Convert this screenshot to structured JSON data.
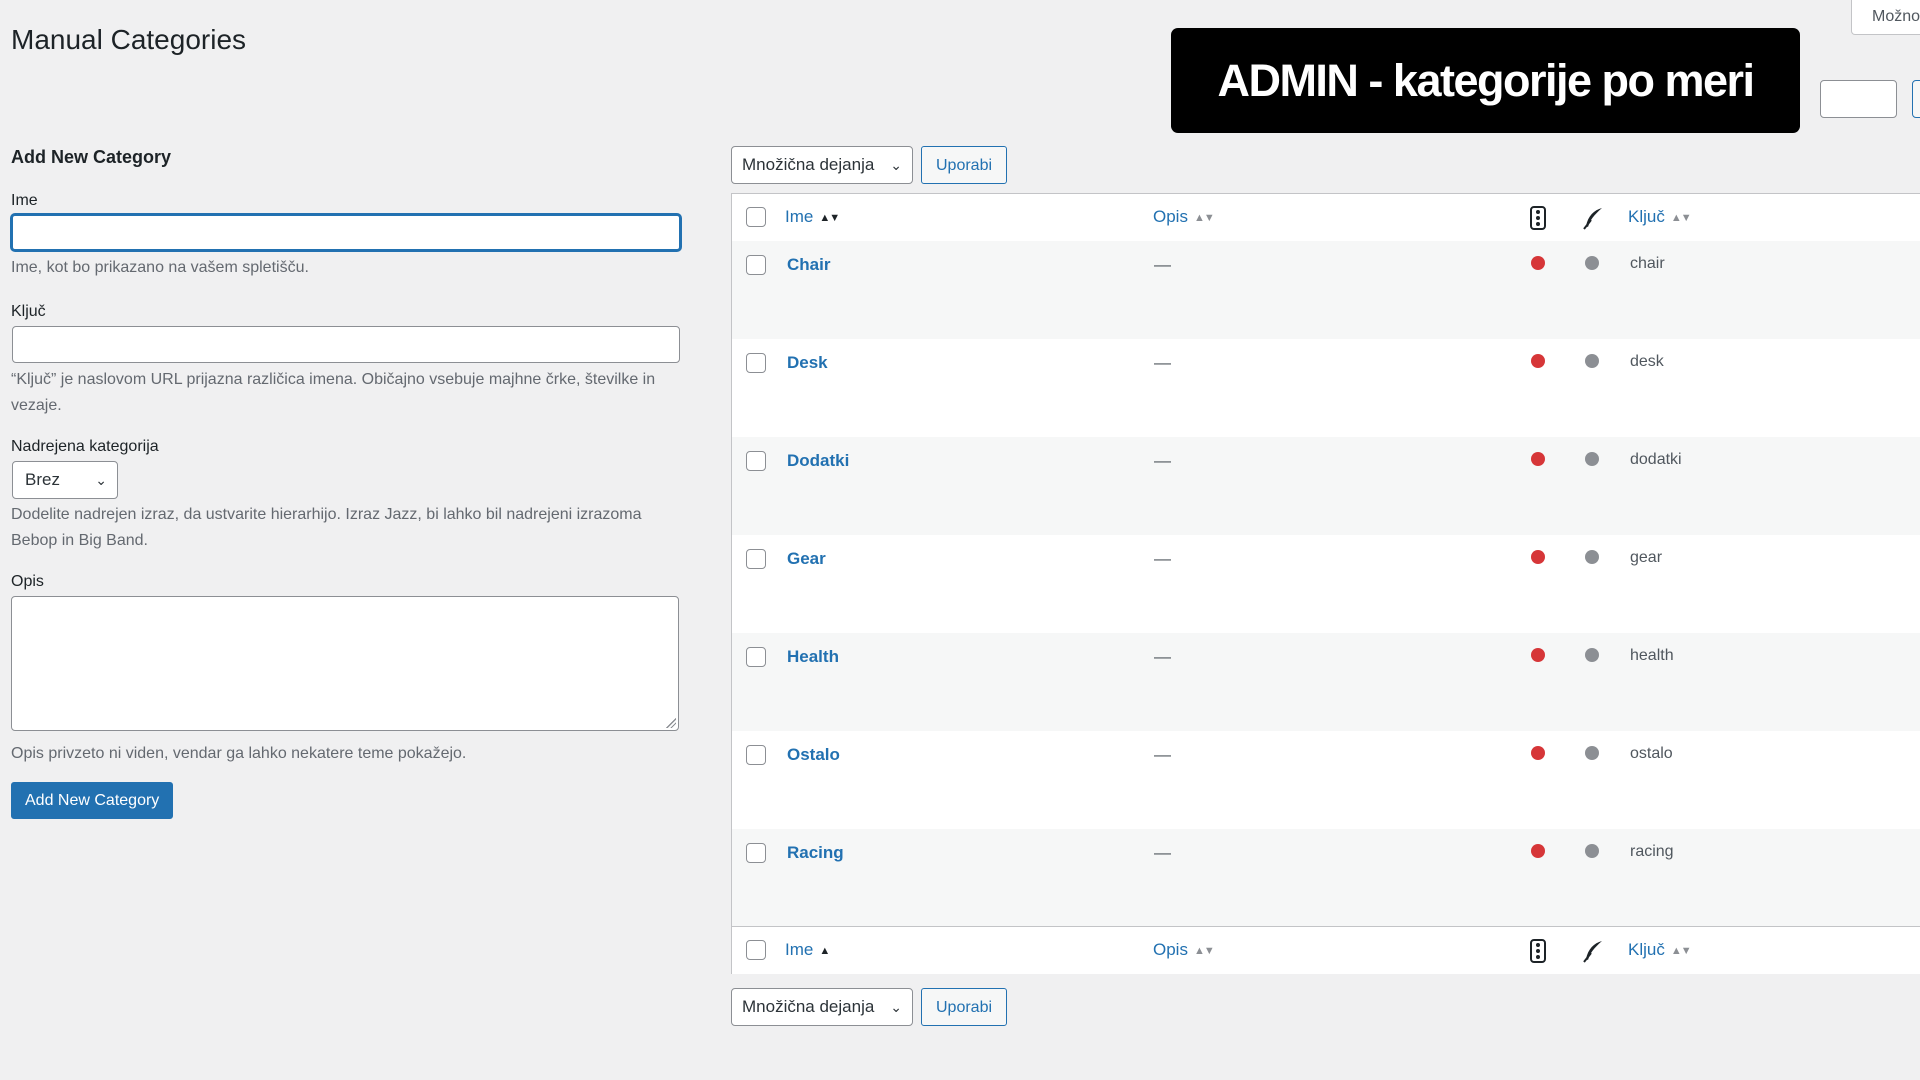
{
  "page": {
    "title": "Manual Categories",
    "screen_options": "Možnosti",
    "banner": "ADMIN - kategorije po meri"
  },
  "form": {
    "heading": "Add New Category",
    "name_label": "Ime",
    "name_value": "",
    "name_desc": "Ime, kot bo prikazano na vašem spletišču.",
    "slug_label": "Ključ",
    "slug_value": "",
    "slug_desc": "“Ključ” je naslovom URL prijazna različica imena. Običajno vsebuje majhne črke, številke in vezaje.",
    "parent_label": "Nadrejena kategorija",
    "parent_value": "Brez",
    "parent_desc": "Dodelite nadrejen izraz, da ustvarite hierarhijo. Izraz Jazz, bi lahko bil nadrejeni izrazoma Bebop in Big Band.",
    "desc_label": "Opis",
    "desc_value": "",
    "desc_desc": "Opis privzeto ni viden, vendar ga lahko nekatere teme pokažejo.",
    "submit_label": "Add New Category"
  },
  "table": {
    "bulk_action": "Množična dejanja",
    "apply_label": "Uporabi",
    "columns": {
      "name": "Ime",
      "description": "Opis",
      "status_icon": "traffic-light-icon",
      "author_icon": "feather-icon",
      "slug": "Ključ"
    },
    "rows": [
      {
        "name": "Chair",
        "description": "—",
        "slug": "chair",
        "status": "red",
        "feather": "gray"
      },
      {
        "name": "Desk",
        "description": "—",
        "slug": "desk",
        "status": "red",
        "feather": "gray"
      },
      {
        "name": "Dodatki",
        "description": "—",
        "slug": "dodatki",
        "status": "red",
        "feather": "gray"
      },
      {
        "name": "Gear",
        "description": "—",
        "slug": "gear",
        "status": "red",
        "feather": "gray"
      },
      {
        "name": "Health",
        "description": "—",
        "slug": "health",
        "status": "red",
        "feather": "gray"
      },
      {
        "name": "Ostalo",
        "description": "—",
        "slug": "ostalo",
        "status": "red",
        "feather": "gray"
      },
      {
        "name": "Racing",
        "description": "—",
        "slug": "racing",
        "status": "red",
        "feather": "gray"
      }
    ]
  },
  "colors": {
    "accent": "#2271b1",
    "status_red": "#d63638",
    "status_gray": "#8c8f94",
    "background": "#f0f0f1"
  }
}
